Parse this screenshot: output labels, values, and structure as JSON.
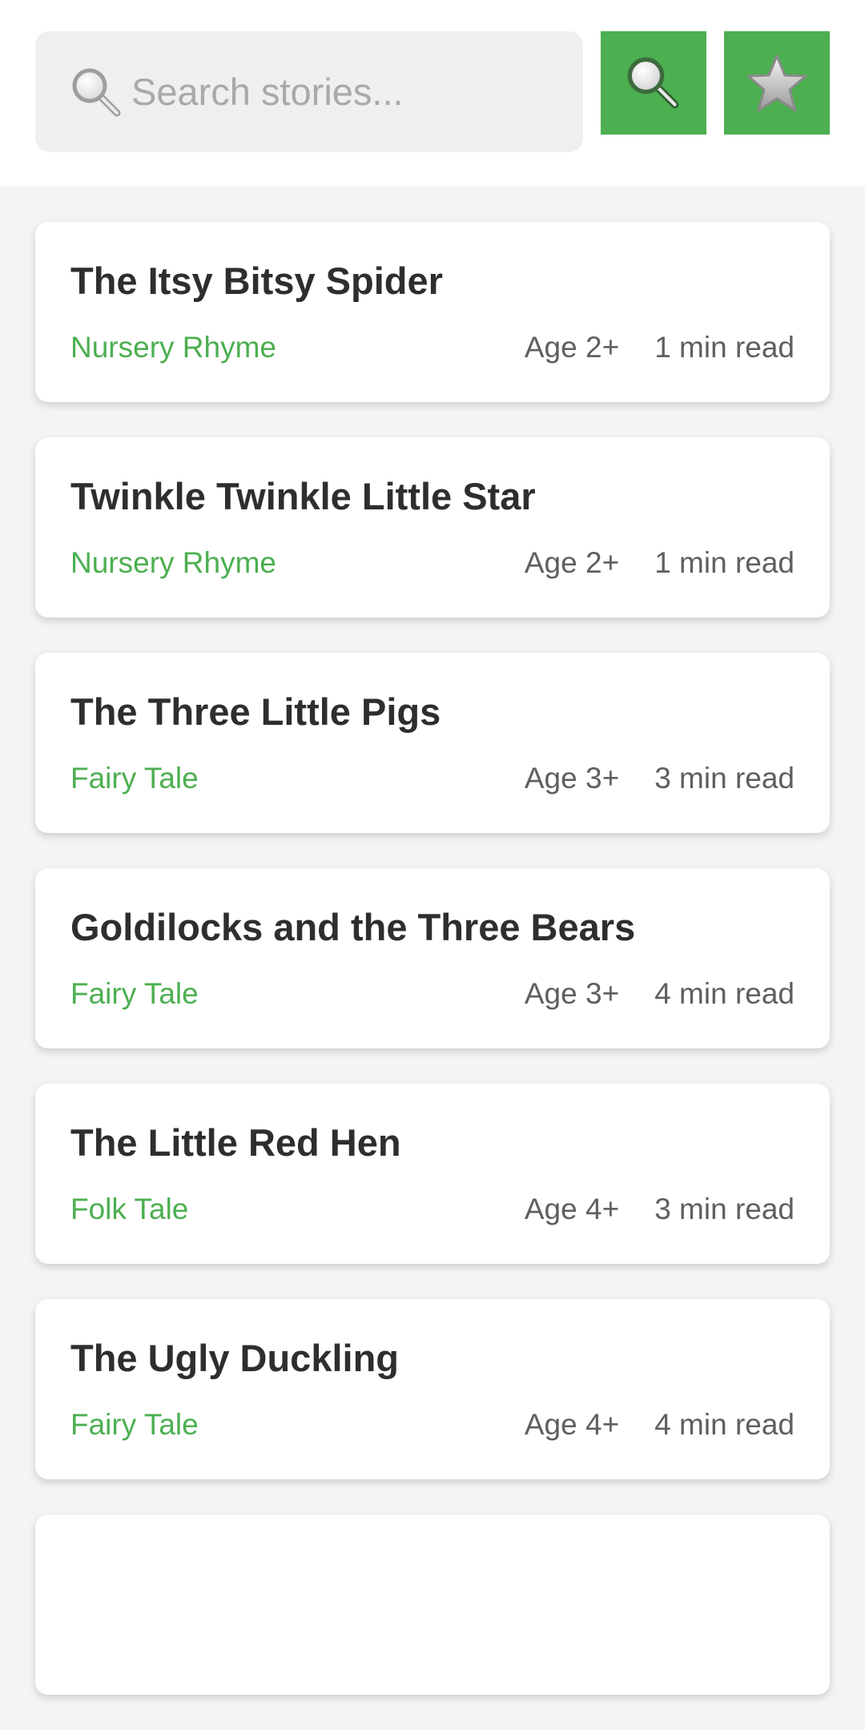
{
  "colors": {
    "accent": "#4caf50",
    "title_text": "#2e2e2e",
    "meta_text": "#5f5f5f",
    "page_bg": "#f4f4f4",
    "search_bg": "#efefef"
  },
  "header": {
    "search": {
      "icon": "magnifier-icon",
      "placeholder": "Search stories...",
      "value": ""
    },
    "search_button_icon": "magnifier-icon",
    "favorites_button_icon": "star-icon"
  },
  "stories": [
    {
      "title": "The Itsy Bitsy Spider",
      "genre": "Nursery Rhyme",
      "age": "Age 2+",
      "read_time": "1 min read"
    },
    {
      "title": "Twinkle Twinkle Little Star",
      "genre": "Nursery Rhyme",
      "age": "Age 2+",
      "read_time": "1 min read"
    },
    {
      "title": "The Three Little Pigs",
      "genre": "Fairy Tale",
      "age": "Age 3+",
      "read_time": "3 min read"
    },
    {
      "title": "Goldilocks and the Three Bears",
      "genre": "Fairy Tale",
      "age": "Age 3+",
      "read_time": "4 min read"
    },
    {
      "title": "The Little Red Hen",
      "genre": "Folk Tale",
      "age": "Age 4+",
      "read_time": "3 min read"
    },
    {
      "title": "The Ugly Duckling",
      "genre": "Fairy Tale",
      "age": "Age 4+",
      "read_time": "4 min read"
    }
  ]
}
